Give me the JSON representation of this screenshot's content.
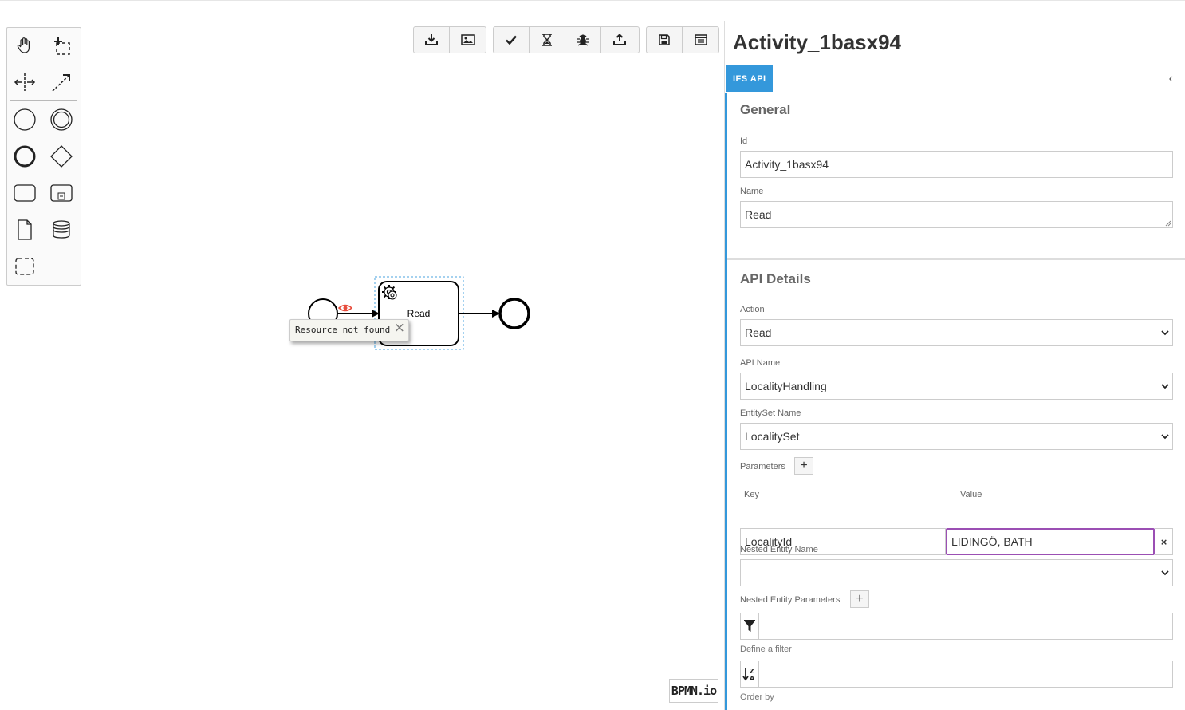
{
  "palette": {
    "tools": [
      "hand-tool",
      "lasso-tool",
      "space-tool",
      "global-connect-tool"
    ],
    "shapes": [
      "start-event",
      "intermediate-event",
      "end-event",
      "gateway",
      "task",
      "subprocess",
      "data-object",
      "data-store",
      "group"
    ]
  },
  "toolbar": {
    "groups": [
      [
        "download-icon",
        "image-icon"
      ],
      [
        "check-icon",
        "hourglass-icon",
        "bug-icon",
        "upload-icon"
      ],
      [
        "save-icon",
        "list-icon"
      ]
    ]
  },
  "diagram": {
    "task_label": "Read",
    "tooltip_text": "Resource not found",
    "tooltip_close": "×",
    "logo": "BPMN.io"
  },
  "panel": {
    "title": "Activity_1basx94",
    "tab": "IFS API",
    "collapse": "‹",
    "general": {
      "title": "General",
      "id_label": "Id",
      "id_value": "Activity_1basx94",
      "name_label": "Name",
      "name_value": "Read"
    },
    "api": {
      "title": "API Details",
      "action_label": "Action",
      "action_value": "Read",
      "api_name_label": "API Name",
      "api_name_value": "LocalityHandling",
      "entityset_label": "EntitySet Name",
      "entityset_value": "LocalitySet",
      "parameters_label": "Parameters",
      "add": "+",
      "key_label": "Key",
      "value_label": "Value",
      "param_key": "LocalityId",
      "param_value": "LIDINGÖ, BATH",
      "remove": "×",
      "nested_entity_label": "Nested Entity Name",
      "nested_entity_value": "",
      "nested_params_label": "Nested Entity Parameters",
      "filter_help": "Define a filter",
      "orderby_help": "Order by"
    }
  },
  "colors": {
    "accent": "#3498db",
    "focus": "#9b4fb4",
    "error": "#e74c3c"
  }
}
